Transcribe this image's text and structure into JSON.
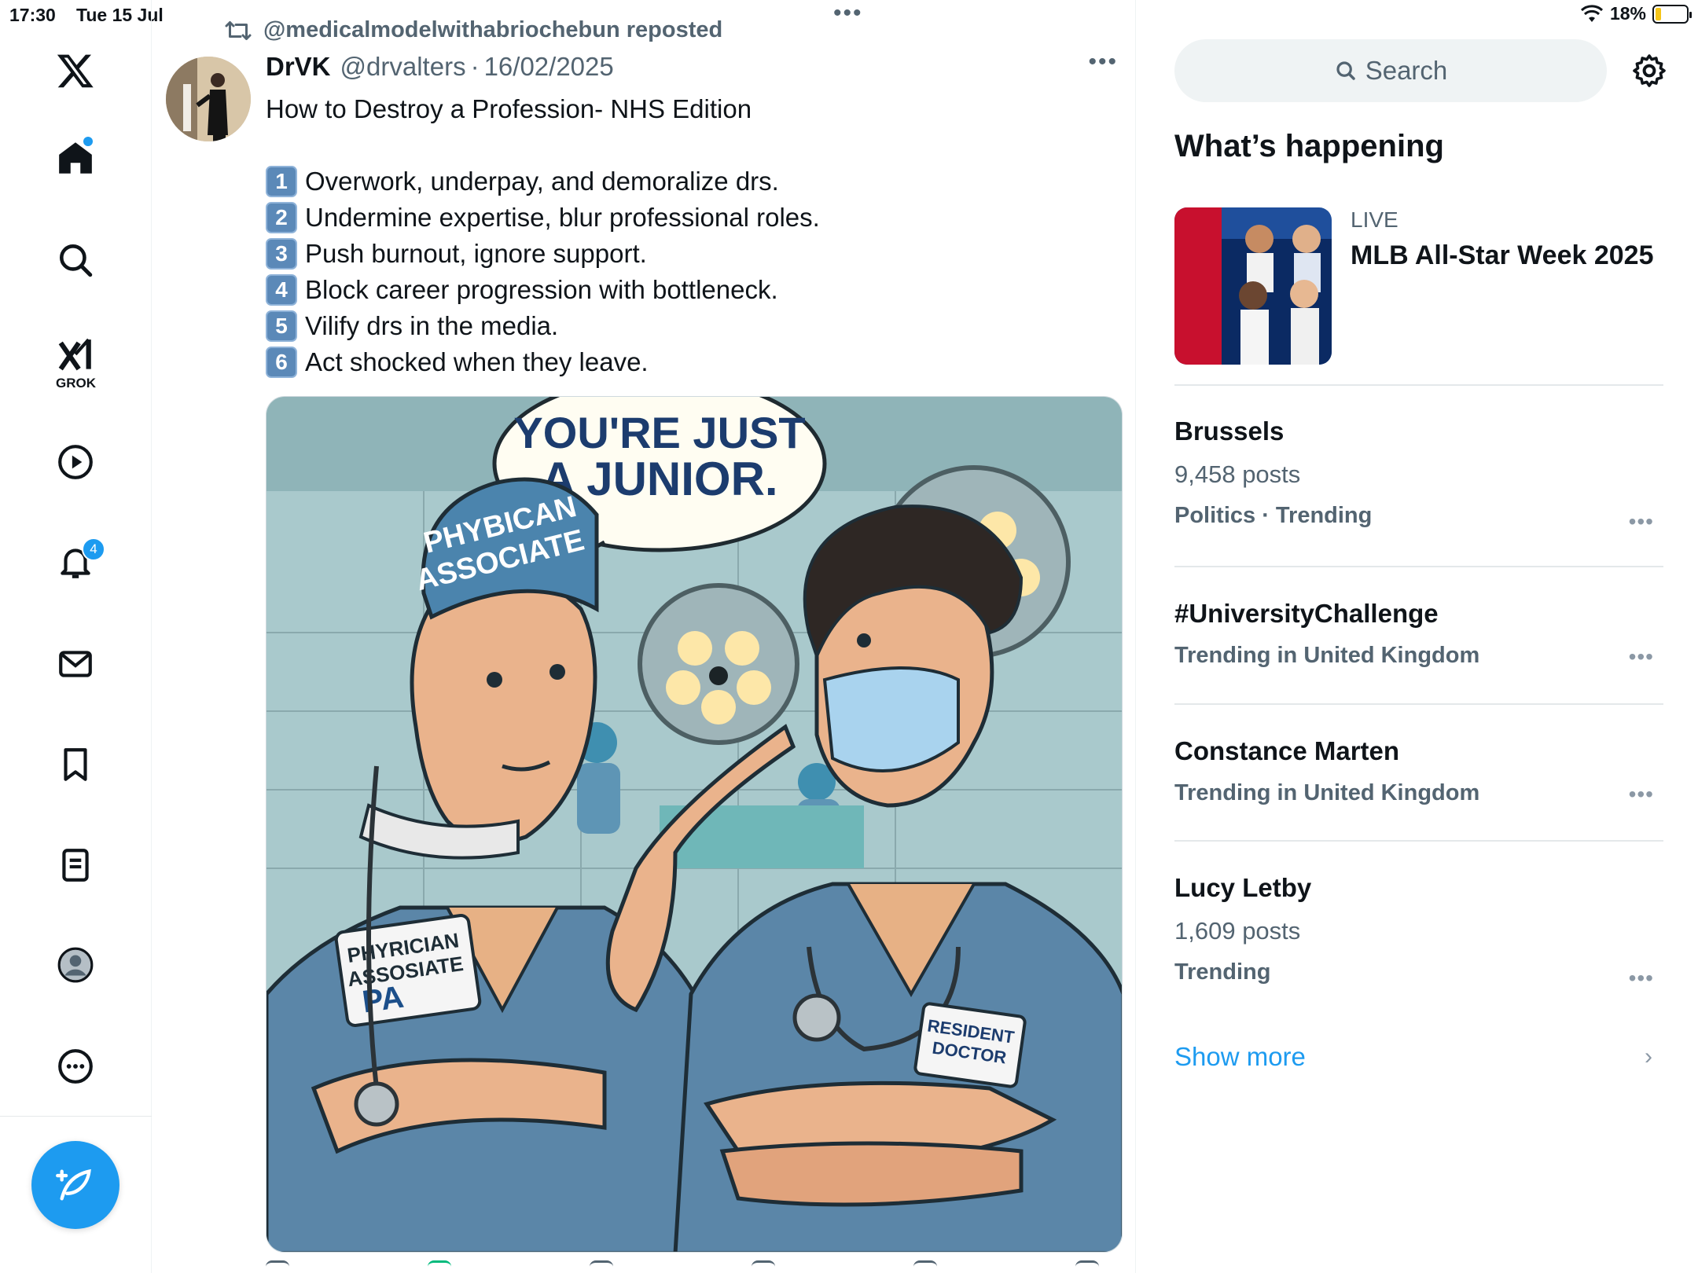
{
  "status_bar": {
    "time": "17:30",
    "date": "Tue 15 Jul",
    "battery": "18%",
    "battery_level": 0.18
  },
  "nav": {
    "logo": "x-logo-icon",
    "items": [
      {
        "name": "home",
        "icon": "home-icon",
        "unread_dot": true
      },
      {
        "name": "explore",
        "icon": "search-icon"
      },
      {
        "name": "grok",
        "icon": "grok-icon",
        "label": "GROK"
      },
      {
        "name": "videos",
        "icon": "play-icon"
      },
      {
        "name": "notifications",
        "icon": "bell-icon",
        "badge": "4"
      },
      {
        "name": "messages",
        "icon": "mail-icon"
      },
      {
        "name": "bookmarks",
        "icon": "bookmark-icon"
      },
      {
        "name": "lists",
        "icon": "list-icon"
      },
      {
        "name": "profile",
        "icon": "avatar-icon"
      },
      {
        "name": "more",
        "icon": "more-icon"
      }
    ],
    "compose_icon": "compose-icon"
  },
  "post": {
    "repost_label": "@medicalmodelwithabriochebun reposted",
    "author_name": "DrVK",
    "author_handle": "@drvalters",
    "separator": "·",
    "date": "16/02/2025",
    "text_title": "How to Destroy a Profession- NHS Edition",
    "list": [
      {
        "num": "1",
        "text": "Overwork, underpay, and demoralize drs."
      },
      {
        "num": "2",
        "text": "Undermine expertise, blur professional roles."
      },
      {
        "num": "3",
        "text": "Push burnout, ignore support."
      },
      {
        "num": "4",
        "text": "Block career progression with bottleneck."
      },
      {
        "num": "5",
        "text": "Vilify drs in the media."
      },
      {
        "num": "6",
        "text": "Act shocked when they leave."
      }
    ],
    "image": {
      "speech_bubble": [
        "YOU'RE JUST",
        "A JUNIOR."
      ],
      "cap_text": [
        "PHYBICAN",
        "ASSOCIATE"
      ],
      "badge_left": [
        "PHYRICIAN",
        "ASSOSIATE",
        "PA"
      ],
      "badge_right": [
        "RESIDENT",
        "DOCTOR"
      ]
    }
  },
  "sidebar": {
    "search_placeholder": "Search",
    "section_title": "What’s happening",
    "live": {
      "label": "LIVE",
      "title": "MLB All-Star Week 2025"
    },
    "trends": [
      {
        "title": "Brussels",
        "posts": "9,458 posts",
        "meta": "Politics · Trending"
      },
      {
        "title": "#UniversityChallenge",
        "posts": "",
        "meta": "Trending in United Kingdom"
      },
      {
        "title": "Constance Marten",
        "posts": "",
        "meta": "Trending in United Kingdom"
      },
      {
        "title": "Lucy Letby",
        "posts": "1,609 posts",
        "meta": "Trending"
      }
    ],
    "show_more": "Show more"
  },
  "colors": {
    "accent": "#1d9bf0",
    "text": "#0f1419",
    "secondary": "#536471"
  }
}
